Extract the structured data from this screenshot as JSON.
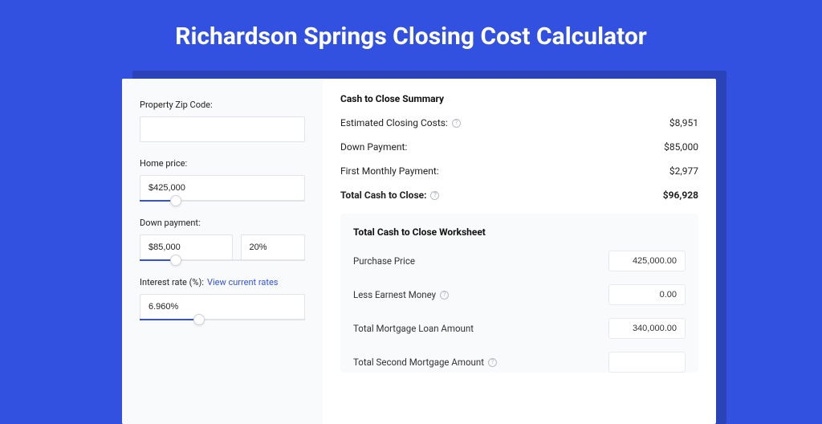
{
  "header": {
    "title": "Richardson Springs Closing Cost Calculator"
  },
  "form": {
    "zip": {
      "label": "Property Zip Code:",
      "value": ""
    },
    "home_price": {
      "label": "Home price:",
      "value": "$425,000",
      "slider_pct": 22
    },
    "down_payment": {
      "label": "Down payment:",
      "value": "$85,000",
      "pct": "20%",
      "slider_pct": 22
    },
    "interest_rate": {
      "label": "Interest rate (%):",
      "link": "View current rates",
      "value": "6.960%",
      "slider_pct": 36
    }
  },
  "summary": {
    "title": "Cash to Close Summary",
    "rows": [
      {
        "label": "Estimated Closing Costs:",
        "info": true,
        "value": "$8,951",
        "bold": false
      },
      {
        "label": "Down Payment:",
        "info": false,
        "value": "$85,000",
        "bold": false
      },
      {
        "label": "First Monthly Payment:",
        "info": false,
        "value": "$2,977",
        "bold": false
      },
      {
        "label": "Total Cash to Close:",
        "info": true,
        "value": "$96,928",
        "bold": true
      }
    ]
  },
  "worksheet": {
    "title": "Total Cash to Close Worksheet",
    "rows": [
      {
        "label": "Purchase Price",
        "info": false,
        "value": "425,000.00"
      },
      {
        "label": "Less Earnest Money",
        "info": true,
        "value": "0.00"
      },
      {
        "label": "Total Mortgage Loan Amount",
        "info": false,
        "value": "340,000.00"
      },
      {
        "label": "Total Second Mortgage Amount",
        "info": true,
        "value": ""
      }
    ]
  }
}
